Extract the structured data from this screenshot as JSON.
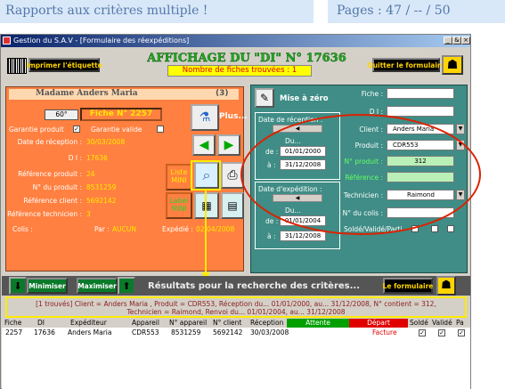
{
  "header": {
    "left": "Rapports aux critères multiple !",
    "right": "Pages : 47 / -- / 50"
  },
  "window": {
    "title": "Gestion du S.A.V - [Formulaire des réexpéditions]",
    "controls": [
      "_",
      "&",
      "×"
    ]
  },
  "toolbar": {
    "print_label": "Imprimer l'étiquette",
    "quit_label": "Quitter le formulaire",
    "title": "AFFICHAGE DU \"DI\" N° 17636",
    "count": "Nombre de fiches trouvées : 1"
  },
  "record": {
    "name": "Madame  Anders  Maria",
    "index": "(3)",
    "temp": "60°",
    "fiche": "Fiche N° 2257",
    "garantie_produit": "Garantie produit",
    "garantie_valide": "Garantie valide",
    "plus": "Plus...",
    "date_reception_label": "Date de réception :",
    "date_reception": "30/03/2008",
    "di_label": "D I :",
    "di": "17636",
    "ref_produit_label": "Référence produit :",
    "ref_produit": "24",
    "no_produit_label": "N° du produit :",
    "no_produit": "8531259",
    "ref_client_label": "Référence client :",
    "ref_client": "5692142",
    "ref_tech_label": "Référence technicien :",
    "ref_tech": "3",
    "colis_label": "Colis :",
    "par_label": "Par :",
    "par": "AUCUN",
    "expedie_label": "Expédié :",
    "expedie": "02/04/2008",
    "liste_label": "Liste MINI",
    "label_btn": "Label MINI"
  },
  "search": {
    "reset": "Mise à zéro",
    "date_reception_label": "Date de réception :",
    "du1": "Du...",
    "de_label": "de :",
    "a_label": "à :",
    "rec_from": "01/01/2000",
    "rec_to": "31/12/2008",
    "date_exp_label": "Date d'expédition :",
    "du2": "Du...",
    "exp_from": "01/01/2004",
    "exp_to": "31/12/2008",
    "fiche_label": "Fiche :",
    "di_label": "D I :",
    "client_label": "Client :",
    "client": "Anders Maria",
    "produit_label": "Produit :",
    "produit": "CDR553",
    "no_produit_label": "N° produit :",
    "no_produit": "312",
    "reference_label": "Référence :",
    "technicien_label": "Technicien :",
    "technicien": "Raimond",
    "colis_label": "N° du colis :",
    "solde_label": "Soldé/Validé/Parti"
  },
  "bar": {
    "minimiser": "Minimiser",
    "maximiser": "Maximiser",
    "results_title": "Résultats pour la recherche des critères...",
    "formulaire": "Le formulaire"
  },
  "criteria": {
    "line1": "[1 trouvés]  Client = Anders  Maria , Produit = CDR553, Réception du... 01/01/2000, au... 31/12/2008, N° contient = 312,",
    "line2": "Technicien = Raimond, Renvoi du... 01/01/2004, au... 31/12/2008"
  },
  "table": {
    "headers": [
      "Fiche",
      "DI",
      "Expéditeur",
      "Appareil",
      "N° appareil",
      "N° client",
      "Réception",
      "Attente",
      "Départ",
      "Soldé",
      "Validé",
      "Pa"
    ],
    "rows": [
      [
        "2257",
        "17636",
        "Anders  Maria",
        "CDR553",
        "8531259",
        "5692142",
        "30/03/2008",
        "",
        "Facture",
        "✓",
        "✓",
        "✓"
      ]
    ]
  },
  "colors": {
    "orange": "#ff8040",
    "teal": "#3f8d86",
    "title_green": "#22aa22",
    "attente_green": "#00a000",
    "depart_red": "#e00000",
    "highlight_yellow": "#ffff00",
    "circle_red": "#dd2200"
  }
}
